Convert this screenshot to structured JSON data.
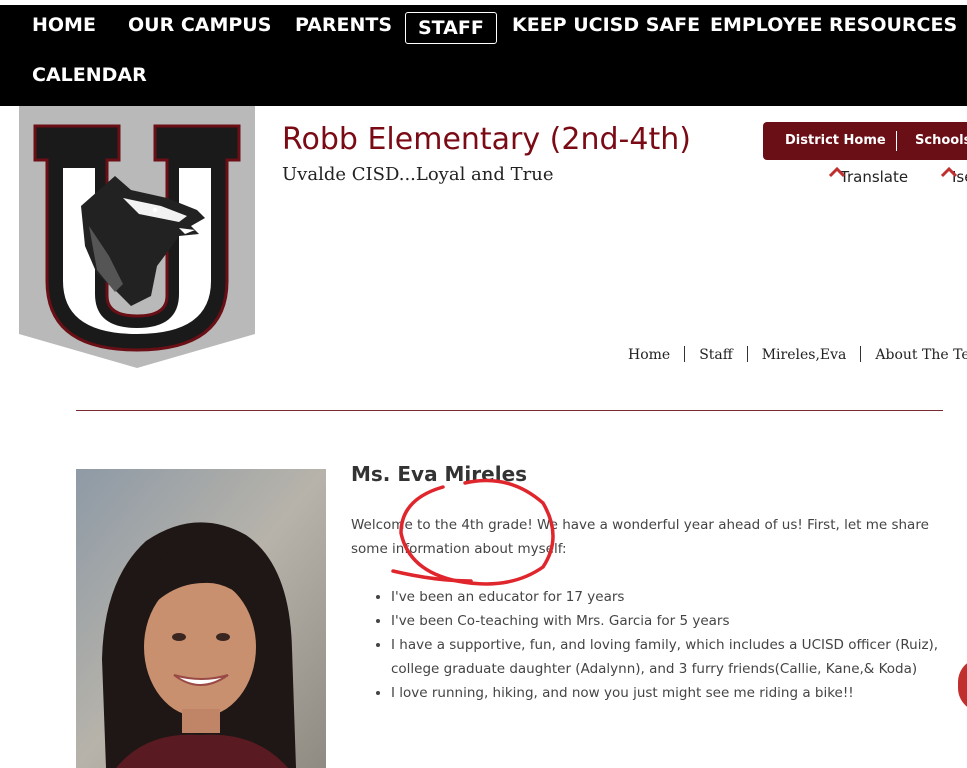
{
  "nav": {
    "items": [
      "HOME",
      "OUR CAMPUS",
      "PARENTS",
      "STAFF",
      "KEEP UCISD SAFE",
      "EMPLOYEE RESOURCES",
      "CALENDAR"
    ],
    "active": "STAFF"
  },
  "header": {
    "title": "Robb Elementary (2nd-4th)",
    "tagline": "Uvalde CISD...Loyal and True",
    "logo_letter": "U"
  },
  "utility": {
    "district_home": "District Home",
    "schools": "Schools",
    "translate": "Translate",
    "second_link_partial": "Ise"
  },
  "breadcrumb": [
    "Home",
    "Staff",
    "Mireles,Eva",
    "About The Teach"
  ],
  "profile": {
    "name": "Ms. Eva Mireles",
    "intro": "Welcome to the 4th grade! We have a wonderful year ahead of us! First, let me share some information about myself:",
    "facts": [
      "I've been an educator for 17 years",
      "I've been Co-teaching with Mrs. Garcia for 5 years",
      "I have a supportive, fun, and loving family, which includes a UCISD officer (Ruiz), college graduate daughter (Adalynn), and 3 furry friends(Callie, Kane,& Koda)",
      "I love running, hiking, and now you just might see me riding a bike!!"
    ]
  },
  "colors": {
    "nav_bg": "#000000",
    "brand_maroon": "#6b0f16",
    "title_maroon": "#7a0a14",
    "annotation_red": "#e0262d"
  }
}
